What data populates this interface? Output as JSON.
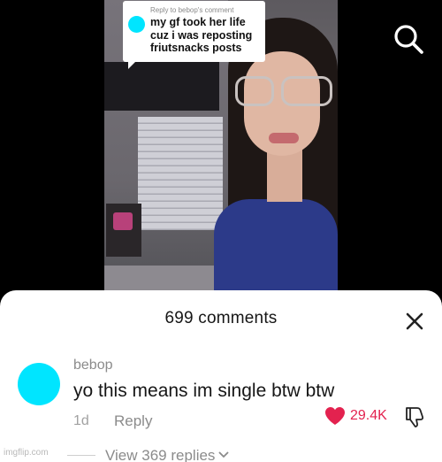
{
  "video": {
    "reply_bubble": {
      "reply_to": "Reply to bebop's comment",
      "text": "my gf took her life cuz i was reposting friutsnacks posts",
      "avatar_color": "#00e5ff"
    },
    "search_icon": "search-icon"
  },
  "comments_sheet": {
    "title": "699 comments",
    "close_icon": "close-icon",
    "comment": {
      "username": "bebop",
      "text": "yo this means im single btw btw",
      "time": "1d",
      "reply_label": "Reply",
      "like_count": "29.4K",
      "like_color": "#e3224f",
      "avatar_color": "#00e5ff",
      "view_replies": "View 369 replies"
    }
  },
  "watermark": "imgflip.com"
}
